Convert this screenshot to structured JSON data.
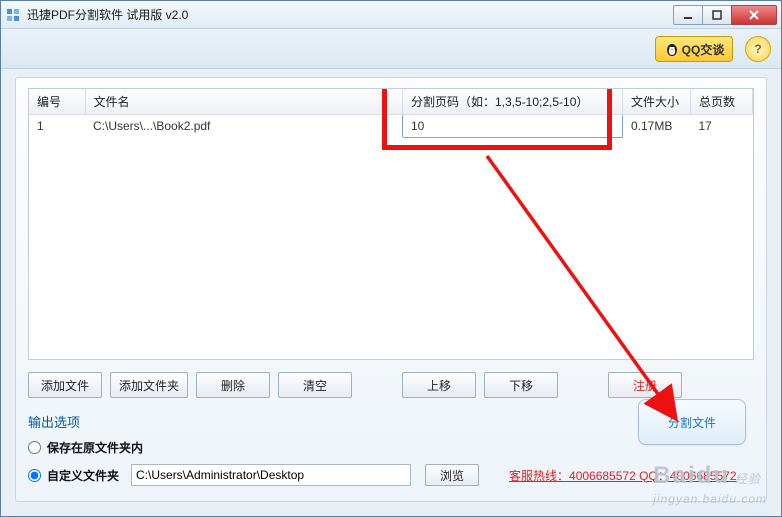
{
  "window": {
    "title": "迅捷PDF分割软件 试用版 v2.0"
  },
  "toolbar": {
    "qq_label": "QQ交谈",
    "help_label": "?"
  },
  "table": {
    "headers": {
      "num": "编号",
      "name": "文件名",
      "pages": "分割页码（如：1,3,5-10;2,5-10）",
      "size": "文件大小",
      "total": "总页数"
    },
    "rows": [
      {
        "num": "1",
        "name": "C:\\Users\\...\\Book2.pdf",
        "pages": "10",
        "size": "0.17MB",
        "total": "17"
      }
    ]
  },
  "buttons": {
    "add_file": "添加文件",
    "add_folder": "添加文件夹",
    "delete": "删除",
    "clear": "清空",
    "move_up": "上移",
    "move_down": "下移",
    "register": "注册",
    "browse": "浏览",
    "split": "分割文件"
  },
  "output": {
    "section_title": "输出选项",
    "save_original": "保存在原文件夹内",
    "custom_folder": "自定义文件夹",
    "path": "C:\\Users\\Administrator\\Desktop"
  },
  "hotline": "客服热线：4006685572 QQ：4006685572",
  "watermark": {
    "brand": "Baidu",
    "sub": "经验",
    "url": "jingyan.baidu.com"
  }
}
